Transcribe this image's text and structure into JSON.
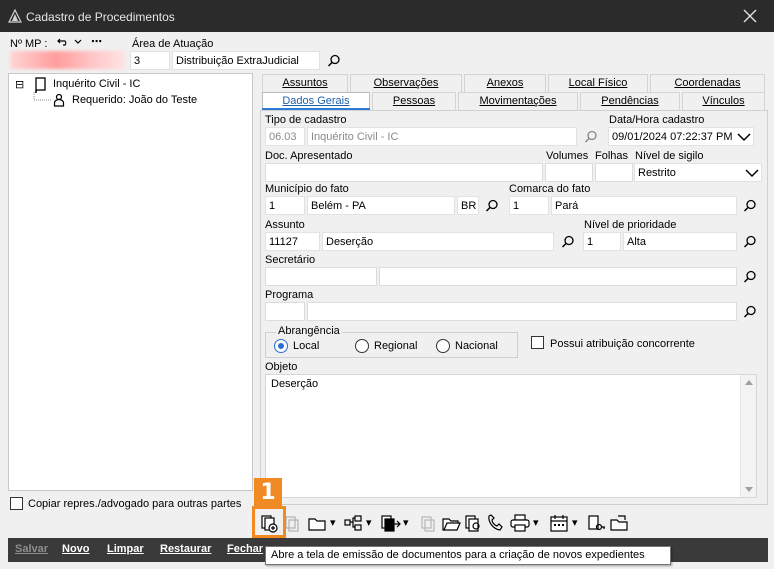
{
  "window": {
    "title": "Cadastro de Procedimentos"
  },
  "header": {
    "mp_label": "Nº MP :",
    "area_label": "Área de Atuação",
    "area_code": "3",
    "area_name": "Distribuição ExtraJudicial"
  },
  "tree": {
    "root": "Inquérito Civil - IC",
    "child": "Requerido: João do Teste",
    "root_toggle": "⊟"
  },
  "tabs_top": [
    "Assuntos",
    "Observações",
    "Anexos",
    "Local Físico",
    "Coordenadas"
  ],
  "tabs_bottom": [
    "Dados Gerais",
    "Pessoas",
    "Movimentações",
    "Pendências",
    "Vínculos"
  ],
  "form": {
    "tipo_label": "Tipo de cadastro",
    "tipo_code": "06.03",
    "tipo_name": "Inquérito Civil - IC",
    "data_label": "Data/Hora cadastro",
    "data_value": "09/01/2024 07:22:37 PM",
    "doc_label": "Doc. Apresentado",
    "volumes_label": "Volumes",
    "folhas_label": "Folhas",
    "sigilo_label": "Nível de sigilo",
    "sigilo_value": "Restrito",
    "municipio_label": "Município do fato",
    "municipio_code": "1",
    "municipio_name": "Belém - PA",
    "municipio_uf": "BR",
    "comarca_label": "Comarca do fato",
    "comarca_code": "1",
    "comarca_name": "Pará",
    "assunto_label": "Assunto",
    "assunto_code": "11127",
    "assunto_name": "Deserção",
    "prioridade_label": "Nível de prioridade",
    "prioridade_code": "1",
    "prioridade_name": "Alta",
    "secretario_label": "Secretário",
    "programa_label": "Programa",
    "abrangencia_label": "Abrangência",
    "radio_local": "Local",
    "radio_regional": "Regional",
    "radio_nacional": "Nacional",
    "concorrente_label": "Possui atribuição concorrente",
    "objeto_label": "Objeto",
    "objeto_value": "Deserção"
  },
  "copiar_label": "Copiar repres./advogado para outras partes",
  "annotation": {
    "badge": "1",
    "color": "#f08a24"
  },
  "bottom_buttons": [
    "Salvar",
    "Novo",
    "Limpar",
    "Restaurar",
    "Fechar"
  ],
  "tooltip": "Abre a tela de emissão de documentos para a criação de novos expedientes",
  "icons": {
    "more": "⋯",
    "undo": "↶",
    "dropdown": "▾"
  }
}
